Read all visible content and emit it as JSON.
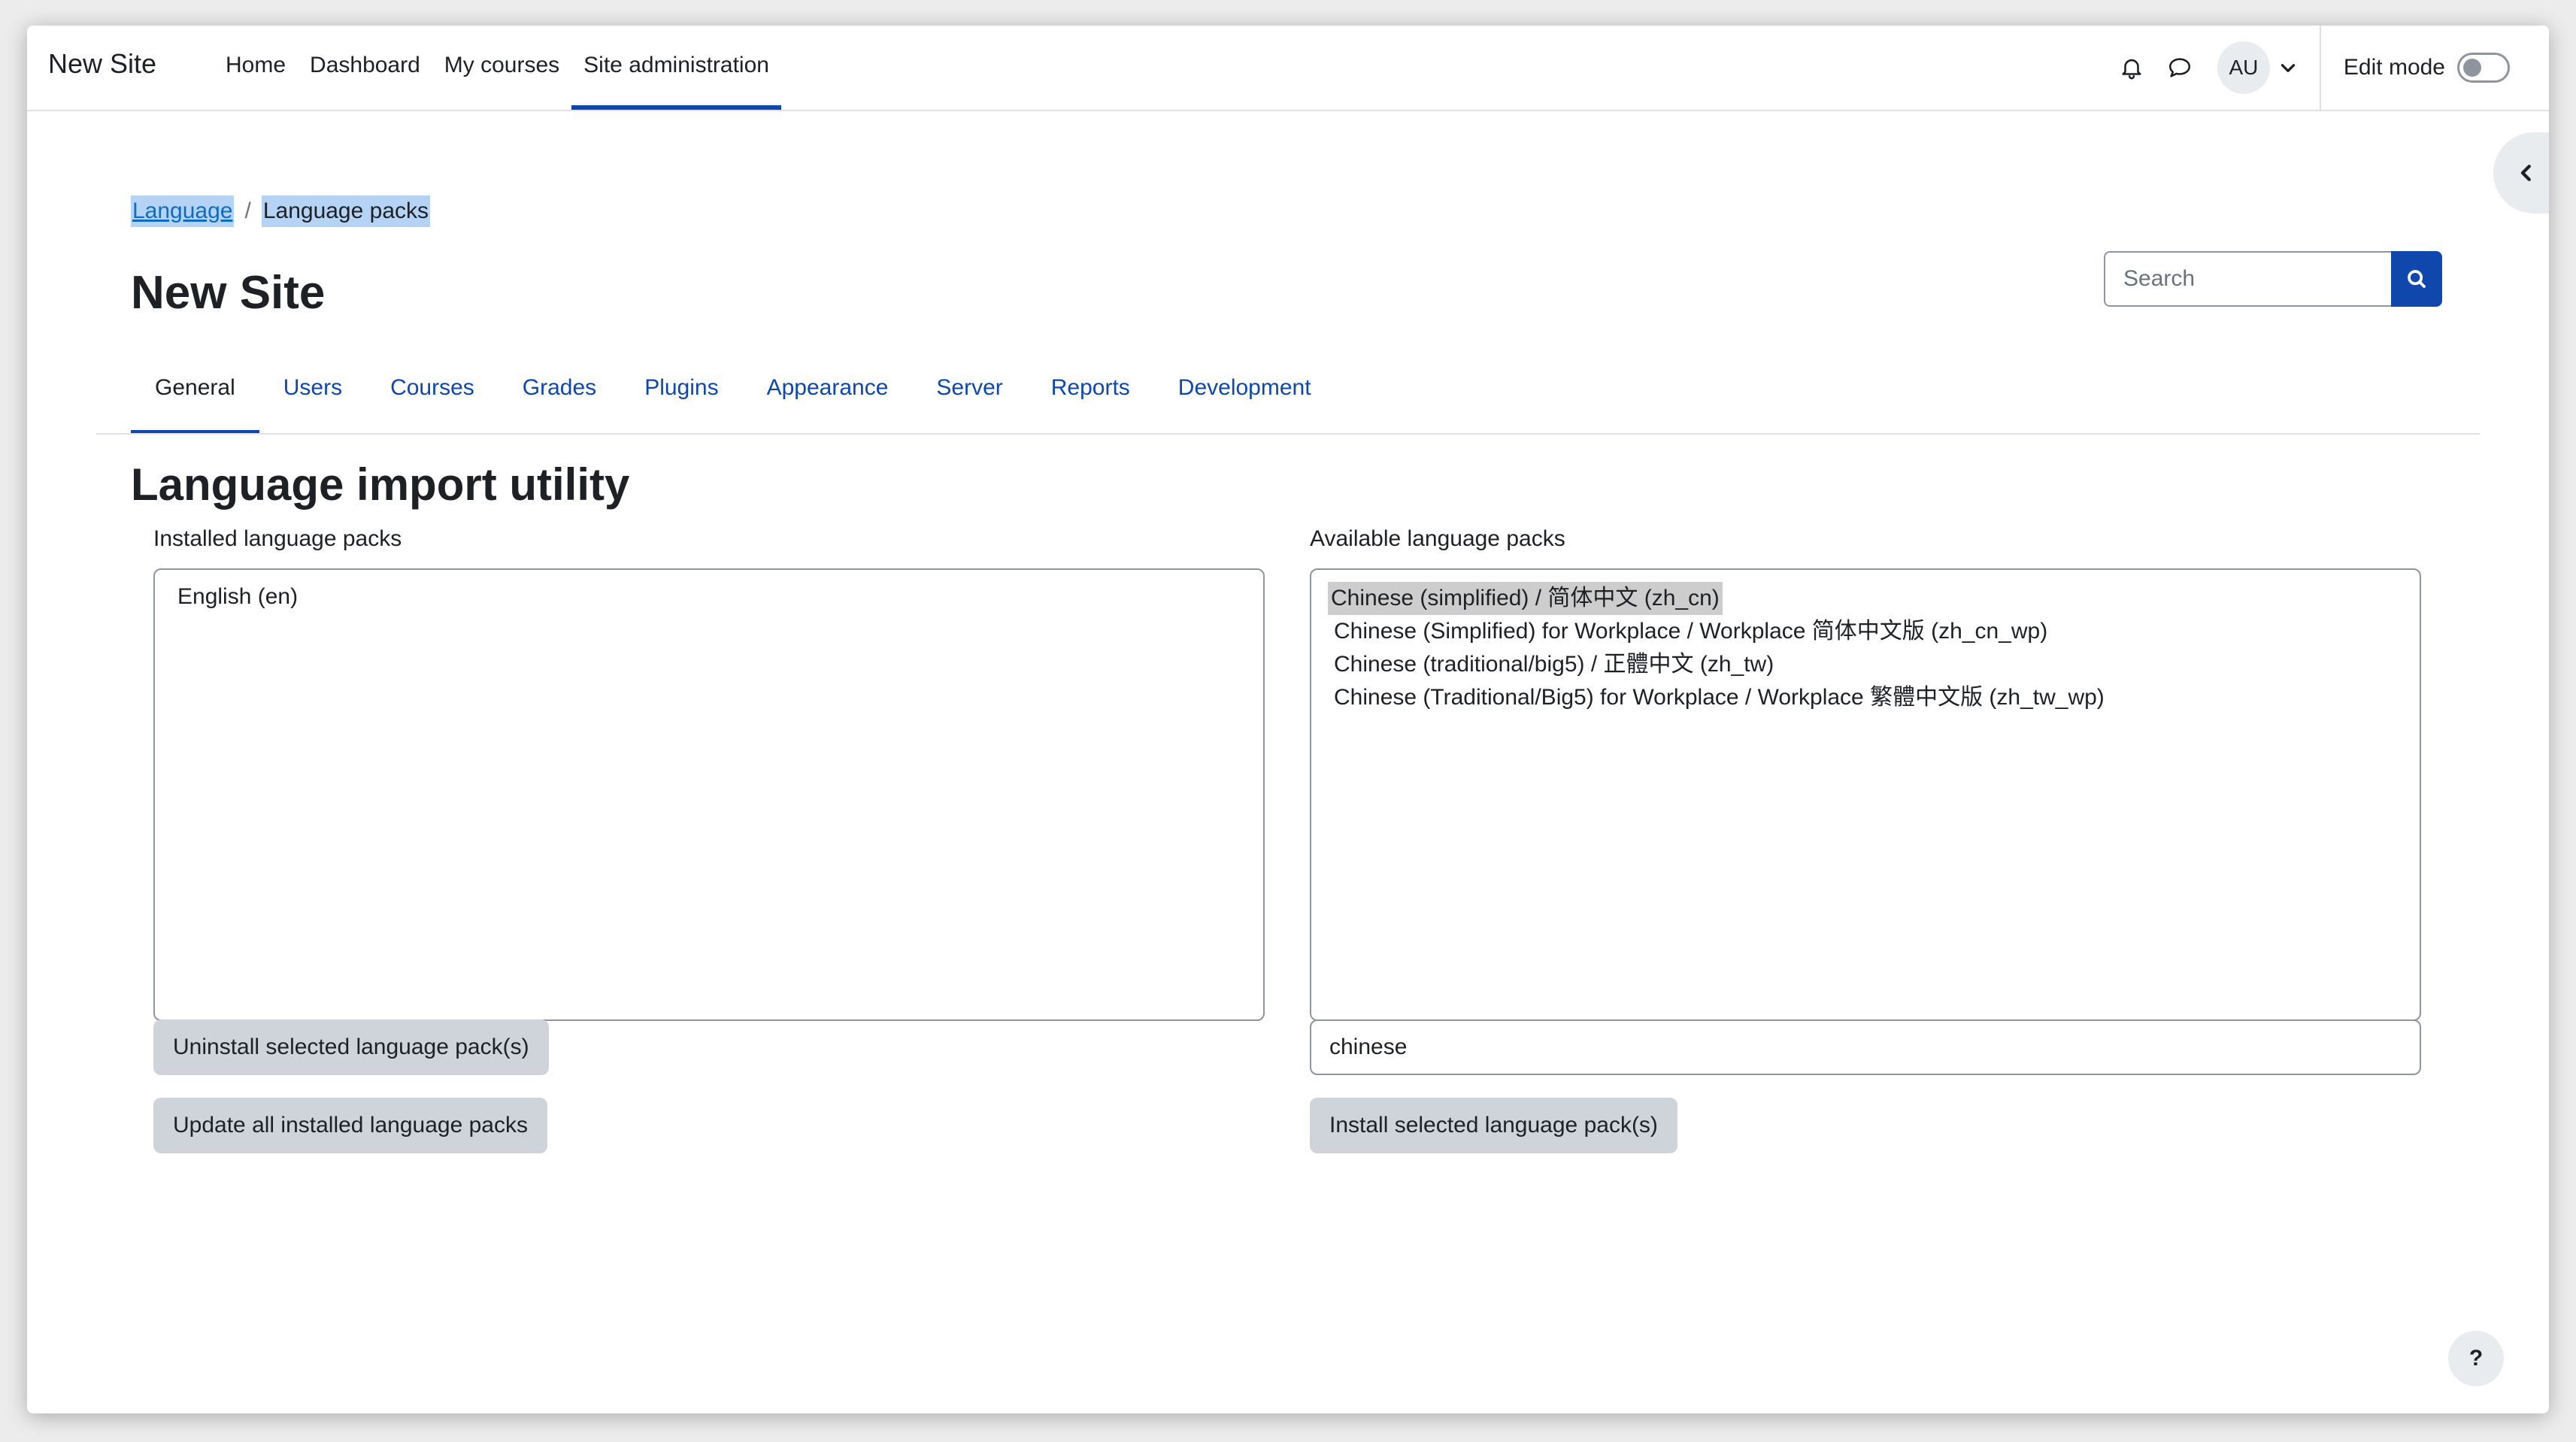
{
  "navbar": {
    "brand": "New Site",
    "items": [
      {
        "label": "Home"
      },
      {
        "label": "Dashboard"
      },
      {
        "label": "My courses"
      },
      {
        "label": "Site administration",
        "active": true
      }
    ],
    "notifications_icon": "bell-icon",
    "messages_icon": "chat-bubble-icon",
    "user_initials": "AU",
    "user_menu_icon": "chevron-down-icon",
    "edit_mode_label": "Edit mode",
    "edit_mode_on": false
  },
  "drawer_toggle_icon": "chevron-left-icon",
  "breadcrumb": [
    {
      "label": "Language"
    },
    {
      "label": "Language packs"
    }
  ],
  "page_title": "New Site",
  "search": {
    "placeholder": "Search",
    "icon": "search-icon"
  },
  "tabs": [
    {
      "label": "General",
      "active": true
    },
    {
      "label": "Users"
    },
    {
      "label": "Courses"
    },
    {
      "label": "Grades"
    },
    {
      "label": "Plugins"
    },
    {
      "label": "Appearance"
    },
    {
      "label": "Server"
    },
    {
      "label": "Reports"
    },
    {
      "label": "Development"
    }
  ],
  "section_title": "Language import utility",
  "installed": {
    "label": "Installed language packs",
    "options": [
      "English (en)"
    ],
    "uninstall_button": "Uninstall selected language pack(s)",
    "update_button": "Update all installed language packs"
  },
  "available": {
    "label": "Available language packs",
    "options": [
      "Chinese (simplified) / 简体中文 (zh_cn)",
      "Chinese (Simplified) for Workplace / Workplace 简体中文版 (zh_cn_wp)",
      "Chinese (traditional/big5) / 正體中文 (zh_tw)",
      "Chinese (Traditional/Big5) for Workplace / Workplace 繁體中文版 (zh_tw_wp)"
    ],
    "selected_index": 0,
    "filter_value": "chinese",
    "install_button": "Install selected language pack(s)"
  },
  "help_button": "?",
  "colors": {
    "primary": "#0f47ad",
    "link": "#0f6cbf",
    "button_secondary": "#ced4da",
    "selection_highlight": "#b4d3f5"
  }
}
